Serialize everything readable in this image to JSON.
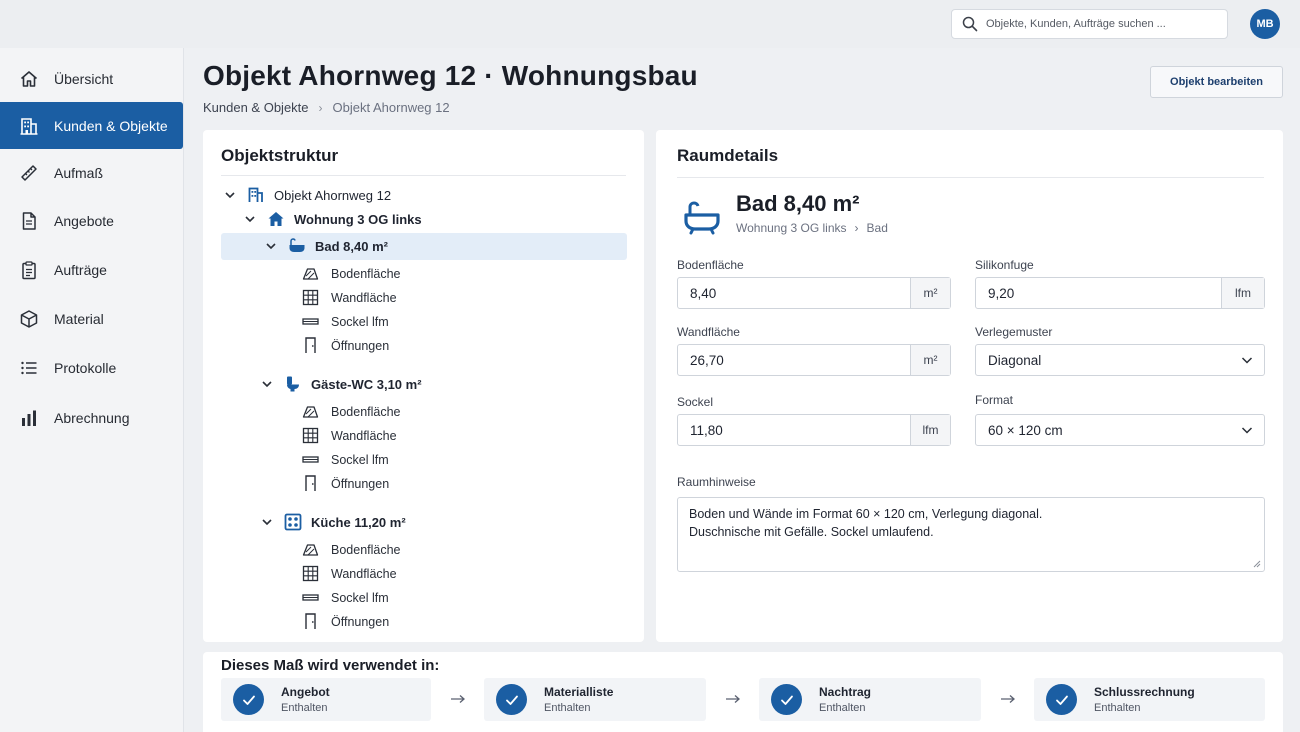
{
  "search": {
    "placeholder": "Objekte, Kunden, Aufträge suchen ..."
  },
  "user": {
    "initials": "MB"
  },
  "sidebar": {
    "items": [
      {
        "label": "Übersicht",
        "icon": "home-icon"
      },
      {
        "label": "Kunden & Objekte",
        "icon": "building-icon",
        "active": true
      },
      {
        "label": "Aufmaß",
        "icon": "ruler-icon"
      },
      {
        "label": "Angebote",
        "icon": "document-icon"
      },
      {
        "label": "Aufträge",
        "icon": "clipboard-icon"
      },
      {
        "label": "Material",
        "icon": "box-icon"
      },
      {
        "label": "Protokolle",
        "icon": "list-icon"
      },
      {
        "label": "Abrechnung",
        "icon": "bar-chart-icon"
      }
    ]
  },
  "header": {
    "title": "Objekt Ahornweg 12 · Wohnungsbau",
    "breadcrumb": [
      "Kunden & Objekte",
      "Objekt Ahornweg 12"
    ],
    "edit_button": "Objekt bearbeiten"
  },
  "structure": {
    "title": "Objektstruktur",
    "object": "Objekt Ahornweg 12",
    "apartment": "Wohnung 3 OG links",
    "rooms": [
      {
        "name": "Bad 8,40 m²",
        "selected": true,
        "icon": "bathtub-icon"
      },
      {
        "name": "Gäste-WC 3,10 m²",
        "icon": "toilet-icon"
      },
      {
        "name": "Küche 11,20 m²",
        "icon": "stove-icon"
      }
    ],
    "measures": [
      "Bodenfläche",
      "Wandfläche",
      "Sockel lfm",
      "Öffnungen"
    ]
  },
  "details": {
    "title": "Raumdetails",
    "room_title": "Bad 8,40 m²",
    "room_path": [
      "Wohnung 3 OG links",
      "Bad"
    ],
    "fields": {
      "bodenflaeche": {
        "label": "Bodenfläche",
        "value": "8,40",
        "unit": "m²"
      },
      "wandflaeche": {
        "label": "Wandfläche",
        "value": "26,70",
        "unit": "m²"
      },
      "sockel": {
        "label": "Sockel",
        "value": "11,80",
        "unit": "lfm"
      },
      "silikonfuge": {
        "label": "Silikonfuge",
        "value": "9,20",
        "unit": "lfm"
      },
      "verlegemuster": {
        "label": "Verlegemuster",
        "value": "Diagonal"
      },
      "format": {
        "label": "Format",
        "value": "60 × 120 cm"
      }
    },
    "notes_label": "Raumhinweise",
    "notes_line1": "Boden und Wände im Format 60 × 120 cm, Verlegung diagonal.",
    "notes_line2": "Duschnische mit Gefälle. Sockel umlaufend."
  },
  "usage": {
    "title": "Dieses Maß wird verwendet in:",
    "steps": [
      {
        "name": "Angebot",
        "status": "Enthalten"
      },
      {
        "name": "Materialliste",
        "status": "Enthalten"
      },
      {
        "name": "Nachtrag",
        "status": "Enthalten"
      },
      {
        "name": "Schlussrechnung",
        "status": "Enthalten"
      }
    ]
  },
  "colors": {
    "accent": "#1b5ea3",
    "selected_bg": "#e3edf8"
  }
}
